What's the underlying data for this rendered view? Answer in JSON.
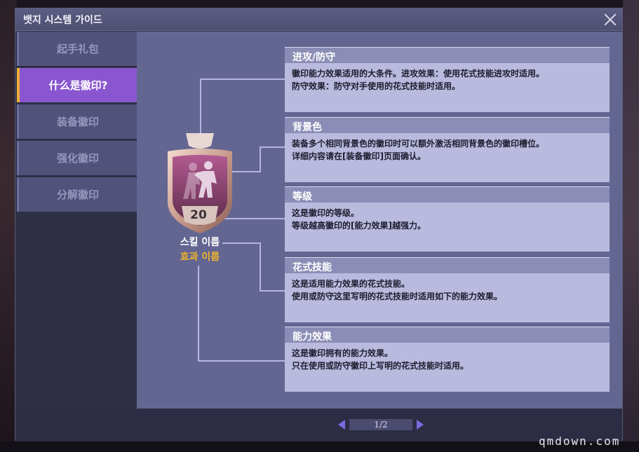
{
  "window": {
    "title": "뱃지 시스템 가이드"
  },
  "sidebar": {
    "items": [
      {
        "label": "起手礼包"
      },
      {
        "label": "什么是徽印?"
      },
      {
        "label": "装备徽印"
      },
      {
        "label": "强化徽印"
      },
      {
        "label": "分解徽印"
      }
    ],
    "active_index": 1
  },
  "badge": {
    "level": "20",
    "skill_name": "스킬 이름",
    "effect_name": "효과 이름"
  },
  "info": [
    {
      "title": "进攻/防守",
      "lines": [
        "徽印能力效果适用的大条件。进攻效果：使用花式技能进攻时适用。",
        "防守效果：防守对手使用的花式技能时适用。"
      ]
    },
    {
      "title": "背景色",
      "lines": [
        "装备多个相同背景色的徽印时可以额外激活相同背景色的徽印槽位。",
        "详细内容请在[装备徽印]页面确认。"
      ]
    },
    {
      "title": "等级",
      "lines": [
        "这是徽印的等级。",
        "等级越高徽印的[能力效果]越强力。"
      ]
    },
    {
      "title": "花式技能",
      "lines": [
        "这是适用能力效果的花式技能。",
        "使用或防守这里写明的花式技能时适用如下的能力效果。"
      ]
    },
    {
      "title": "能力效果",
      "lines": [
        "这是徽印拥有的能力效果。",
        "只在使用或防守徽印上写明的花式技能时适用。"
      ]
    }
  ],
  "pager": {
    "label": "1/2"
  },
  "watermark": "qmdown.com",
  "colors": {
    "accent_tab": "#8a56d0",
    "tab_indicator": "#f0b030",
    "effect_text": "#f0b428",
    "pager_arrow": "#7a6ae0"
  }
}
